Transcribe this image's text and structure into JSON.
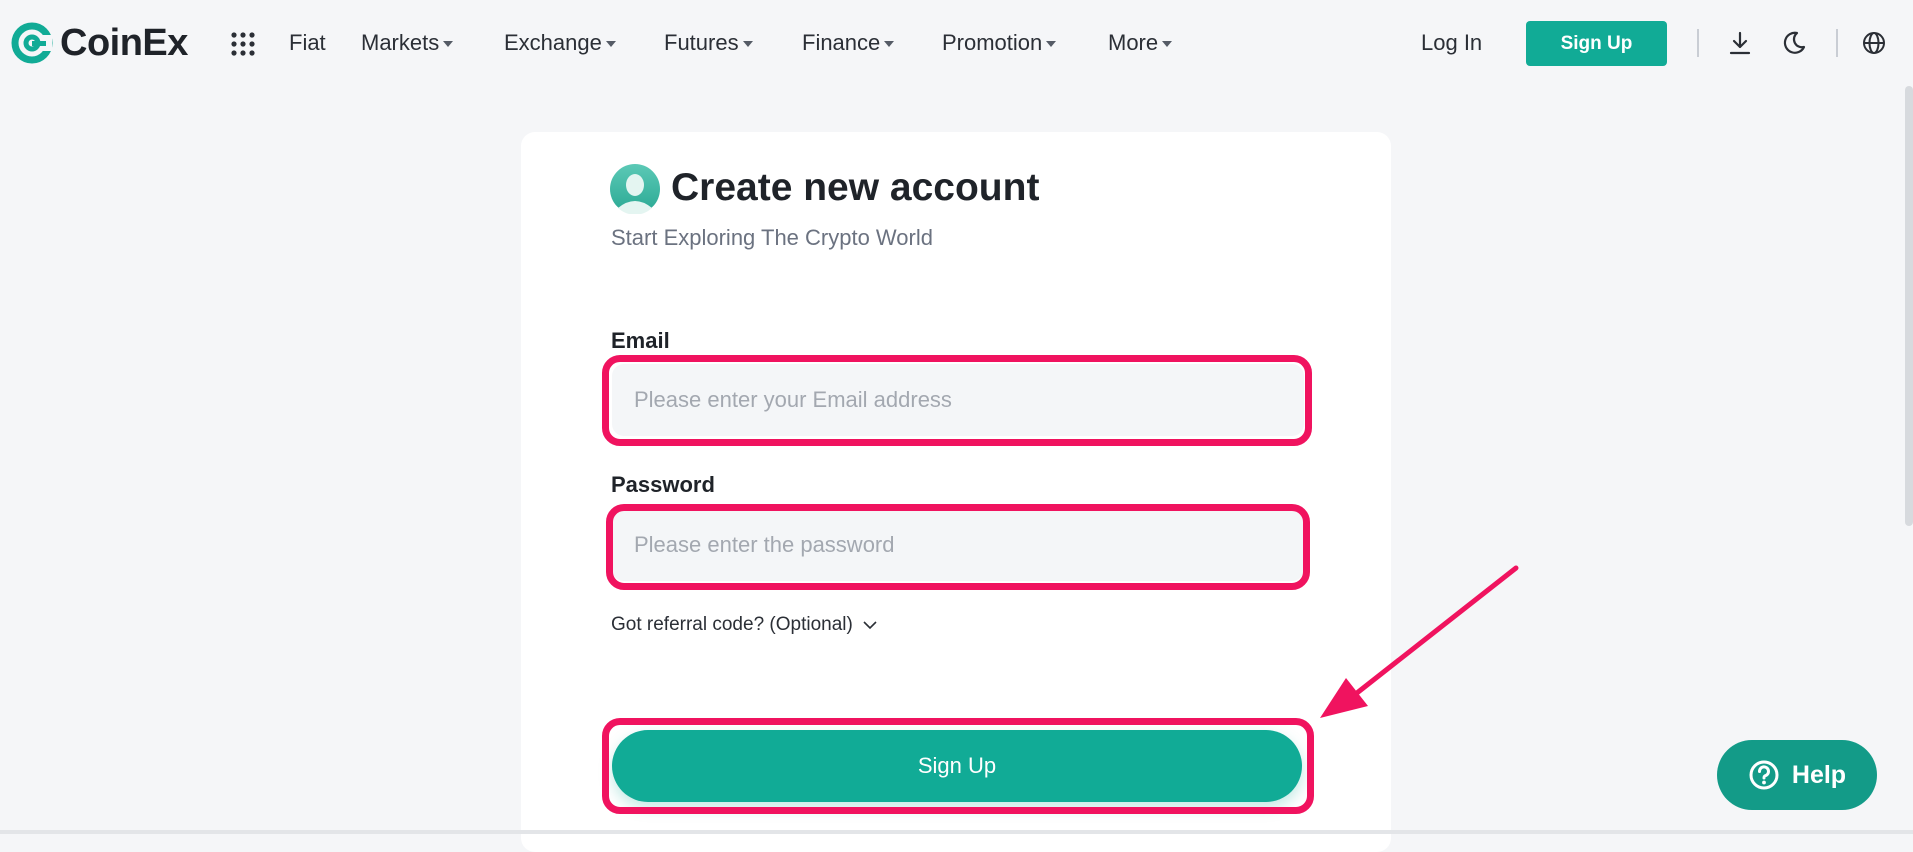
{
  "header": {
    "logo_text": "CoinEx",
    "brand_color": "#11ab96",
    "nav": [
      {
        "label": "Fiat",
        "has_caret": false
      },
      {
        "label": "Markets",
        "has_caret": true
      },
      {
        "label": "Exchange",
        "has_caret": true
      },
      {
        "label": "Futures",
        "has_caret": true
      },
      {
        "label": "Finance",
        "has_caret": true
      },
      {
        "label": "Promotion",
        "has_caret": true
      },
      {
        "label": "More",
        "has_caret": true
      }
    ],
    "login_label": "Log In",
    "signup_label": "Sign Up",
    "icons": [
      "apps-grid-icon",
      "download-icon",
      "moon-icon",
      "globe-icon"
    ]
  },
  "form": {
    "title": "Create new account",
    "subtitle": "Start Exploring The Crypto World",
    "email_label": "Email",
    "email_placeholder": "Please enter your Email address",
    "email_value": "",
    "password_label": "Password",
    "password_placeholder": "Please enter the password",
    "password_value": "",
    "referral_label": "Got referral code? (Optional)",
    "submit_label": "Sign Up",
    "highlight_color": "#f0135f"
  },
  "help": {
    "label": "Help"
  }
}
